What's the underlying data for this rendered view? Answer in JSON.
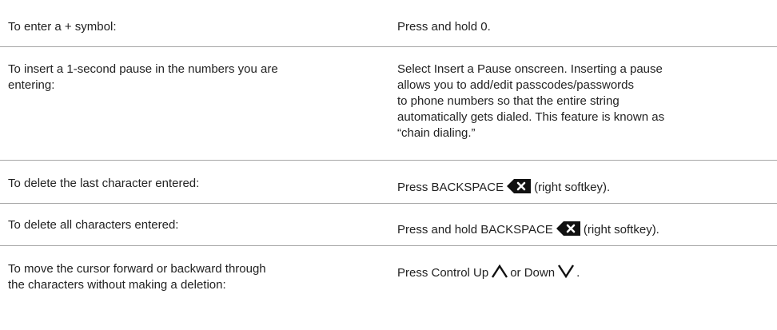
{
  "rows": [
    {
      "instruction": "To enter a + symbol:",
      "action": "Press and hold 0."
    },
    {
      "instruction_lines": [
        "To insert a 1-second pause in the numbers you are",
        "entering:"
      ],
      "action_lines": [
        "Select Insert a Pause onscreen. Inserting a pause",
        "allows you to add/edit passcodes/passwords",
        "to phone numbers so that the entire string",
        "automatically gets dialed. This feature is known as",
        "“chain dialing.”"
      ]
    },
    {
      "instruction": "To delete the last character entered:",
      "action_prefix": "Press BACKSPACE",
      "action_icon": "backspace-icon",
      "action_suffix": "(right softkey)."
    },
    {
      "instruction": "To delete all characters entered:",
      "action_prefix": "Press and hold BACKSPACE",
      "action_icon": "backspace-icon",
      "action_suffix": "(right softkey)."
    },
    {
      "instruction_lines": [
        "To move the cursor forward or backward through",
        "the characters without making a deletion:"
      ],
      "action_part1": "Press Control Up",
      "icon_up": "up-chevron-icon",
      "action_part2": "or Down",
      "icon_down": "down-chevron-icon",
      "action_part3": "."
    }
  ]
}
